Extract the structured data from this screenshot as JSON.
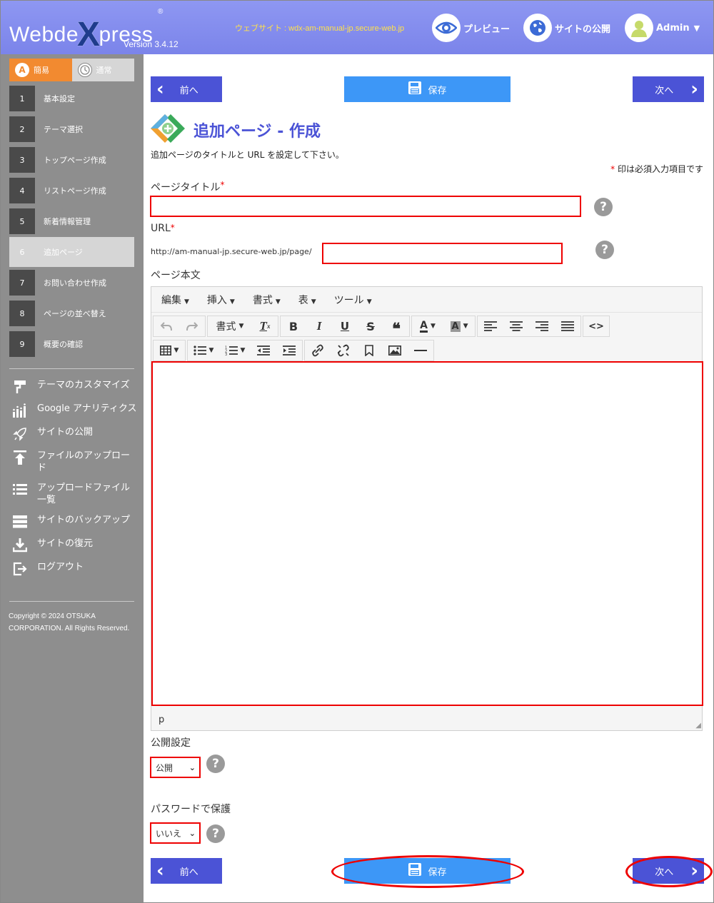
{
  "header": {
    "logo_pre": "Webde",
    "logo_x": "X",
    "logo_post": "press",
    "reg": "®",
    "version": "Version 3.4.12",
    "site_url": "ウェブサイト : wdx-am-manual-jp.secure-web.jp",
    "preview_label": "プレビュー",
    "publish_label": "サイトの公開",
    "admin_label": "Admin"
  },
  "sidebar": {
    "mode_easy": "簡易",
    "mode_normal": "通常",
    "steps": [
      {
        "num": "1",
        "label": "基本設定"
      },
      {
        "num": "2",
        "label": "テーマ選択"
      },
      {
        "num": "3",
        "label": "トップページ作成"
      },
      {
        "num": "4",
        "label": "リストページ作成"
      },
      {
        "num": "5",
        "label": "新着情報管理"
      },
      {
        "num": "6",
        "label": "追加ページ"
      },
      {
        "num": "7",
        "label": "お問い合わせ作成"
      },
      {
        "num": "8",
        "label": "ページの並べ替え"
      },
      {
        "num": "9",
        "label": "概要の確認"
      }
    ],
    "tools": [
      "テーマのカスタマイズ",
      "Google アナリティクス",
      "サイトの公開",
      "ファイルのアップロード",
      "アップロードファイル一覧",
      "サイトのバックアップ",
      "サイトの復元",
      "ログアウト"
    ],
    "copyright": "Copyright © 2024 OTSUKA CORPORATION. All Rights Reserved."
  },
  "nav": {
    "prev": "前へ",
    "save": "保存",
    "next": "次へ"
  },
  "page": {
    "title": "追加ページ - 作成",
    "description": "追加ページのタイトルと URL を設定して下さい。",
    "required_mark": "*",
    "required_note": "印は必須入力項目です",
    "title_label": "ページタイトル",
    "url_label": "URL",
    "url_prefix": "http://am-manual-jp.secure-web.jp/page/",
    "body_label": "ページ本文",
    "help": "?"
  },
  "editor": {
    "menus": [
      "編集",
      "挿入",
      "書式",
      "表",
      "ツール"
    ],
    "format_label": "書式",
    "status_path": "p"
  },
  "publish": {
    "label": "公開設定",
    "value": "公開"
  },
  "password": {
    "label": "パスワードで保護",
    "value": "いいえ"
  },
  "colors": {
    "accent": "#4b53d6",
    "save": "#3d97f7",
    "highlight": "#e00000"
  }
}
